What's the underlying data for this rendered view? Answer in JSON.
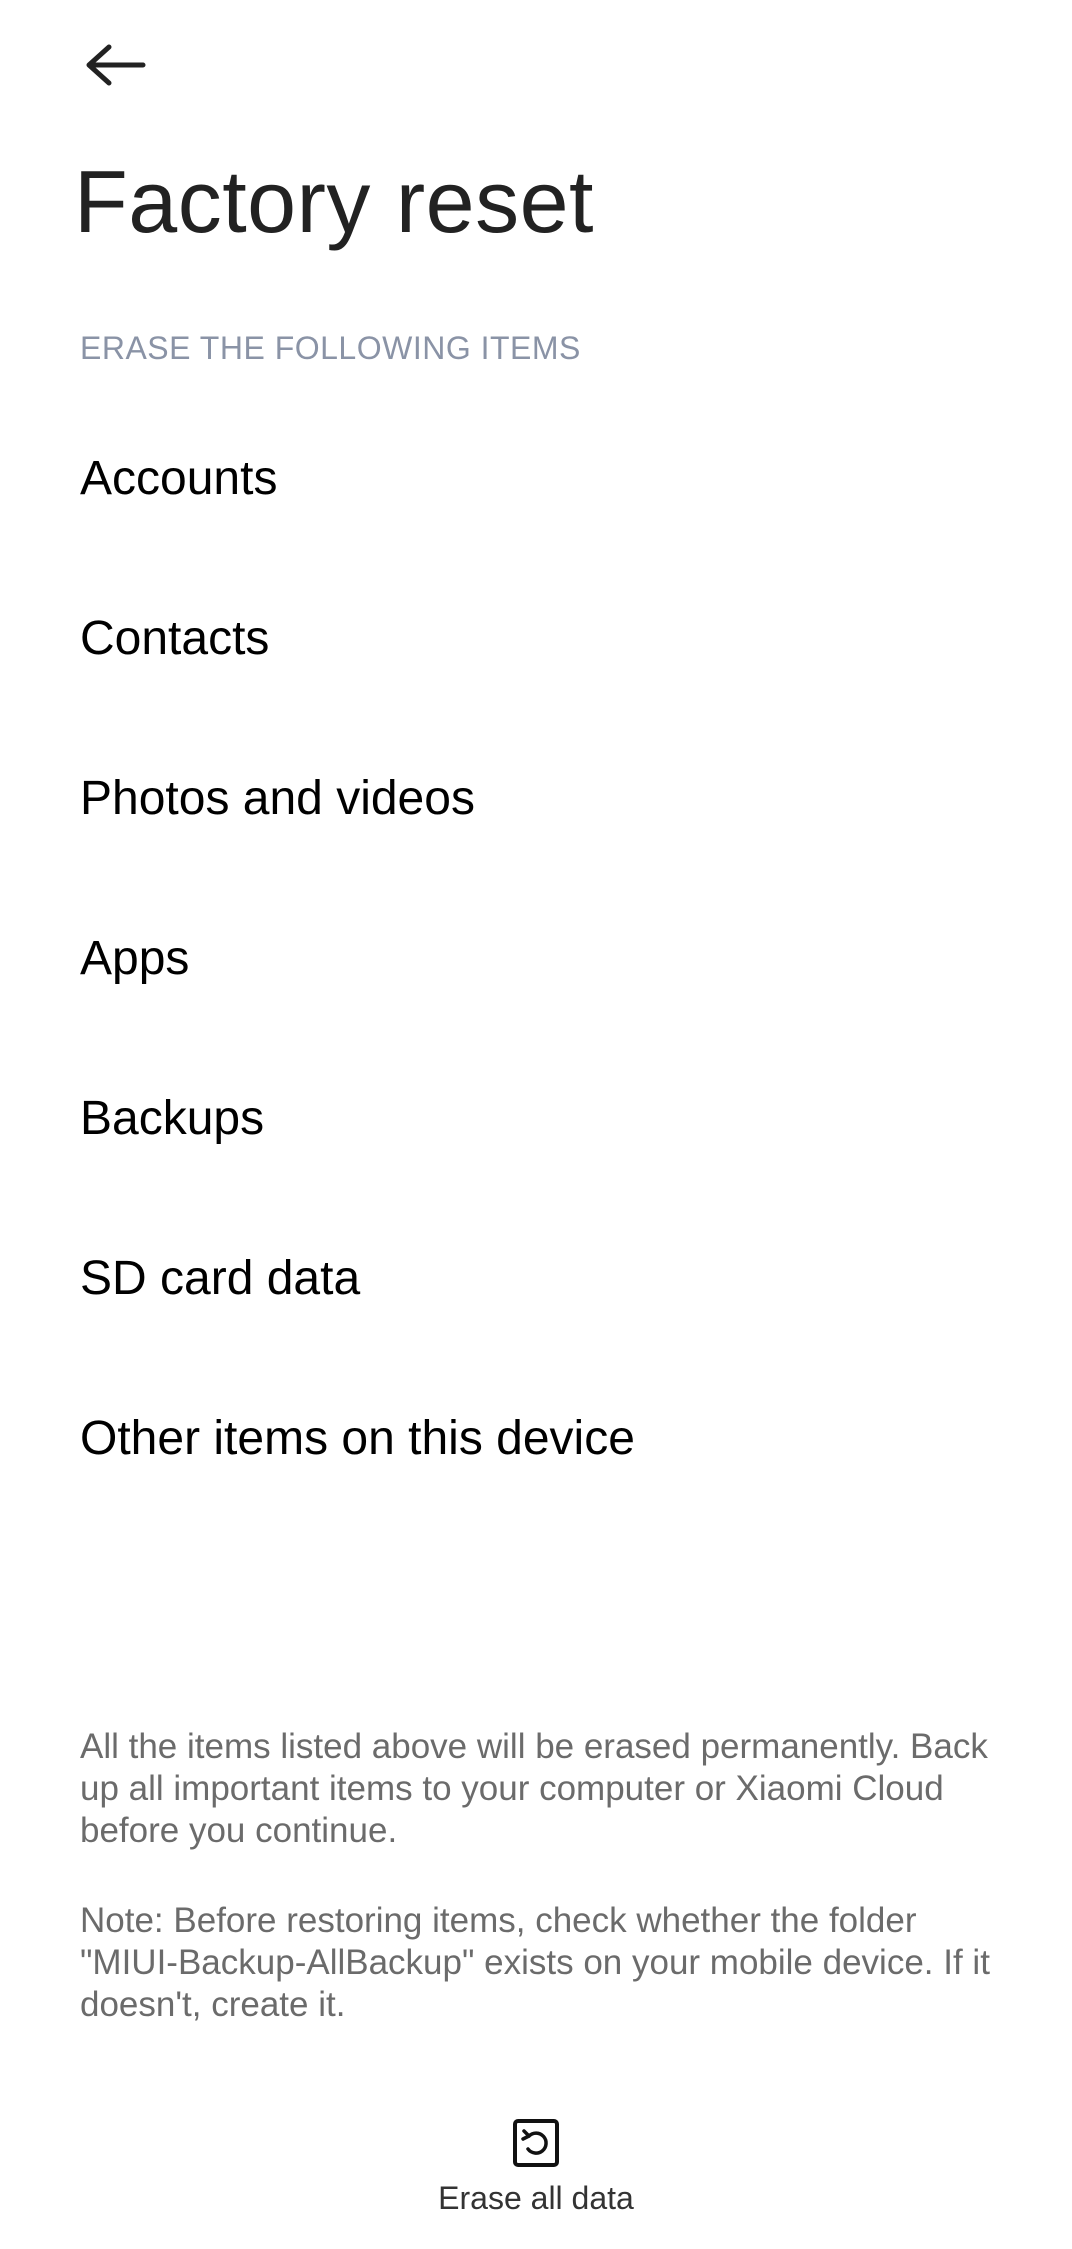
{
  "header": {
    "back_icon": "arrow-left-icon",
    "title": "Factory reset"
  },
  "section": {
    "header": "ERASE THE FOLLOWING ITEMS",
    "items": [
      {
        "label": "Accounts"
      },
      {
        "label": "Contacts"
      },
      {
        "label": "Photos and videos"
      },
      {
        "label": "Apps"
      },
      {
        "label": "Backups"
      },
      {
        "label": "SD card data"
      },
      {
        "label": "Other items on this device"
      }
    ]
  },
  "notes": {
    "warning": "All the items listed above will be erased permanently. Back up all important items to your computer or Xiaomi Cloud before you continue.",
    "note": "Note: Before restoring items, check whether the folder \"MIUI-Backup-AllBackup\" exists on your mobile device. If it doesn't, create it."
  },
  "action": {
    "icon": "reset-icon",
    "label": "Erase all data"
  }
}
